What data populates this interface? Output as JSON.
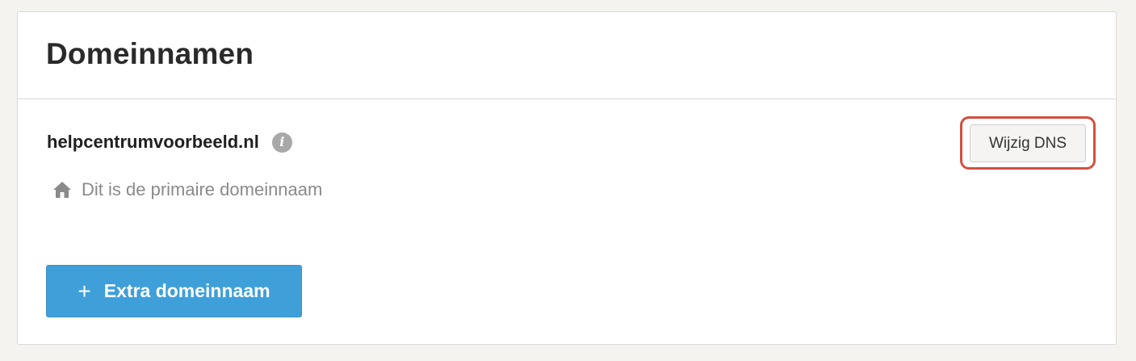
{
  "panel": {
    "title": "Domeinnamen"
  },
  "domain": {
    "name": "helpcentrumvoorbeeld.nl",
    "info_icon": "info-icon",
    "info_glyph": "i",
    "primary_icon": "home-icon",
    "primary_note": "Dit is de primaire domeinnaam",
    "change_dns_label": "Wijzig DNS",
    "highlight_color": "#d4503f"
  },
  "actions": {
    "add_domain_icon": "plus-icon",
    "add_domain_glyph": "+",
    "add_domain_label": "Extra domeinnaam",
    "accent_color": "#3f9fd9"
  }
}
